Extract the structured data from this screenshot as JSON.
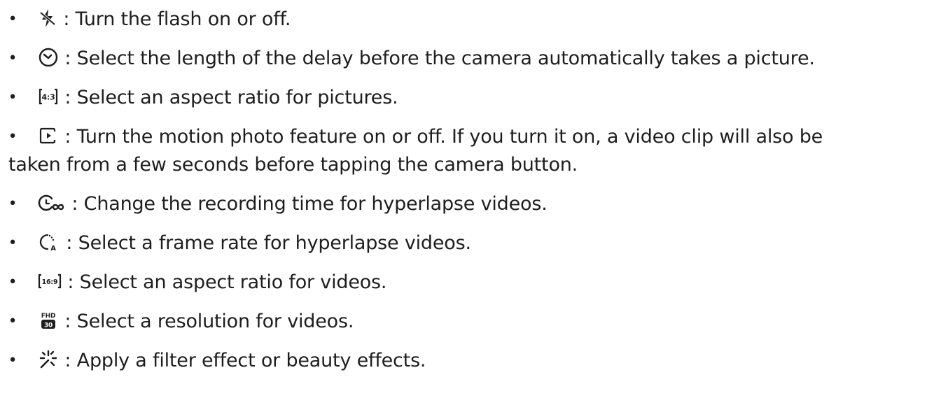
{
  "items": [
    {
      "icon": "flash-off-icon",
      "separator": " : ",
      "text": "Turn the flash on or off."
    },
    {
      "icon": "timer-icon",
      "separator": " : ",
      "text": "Select the length of the delay before the camera automatically takes a picture."
    },
    {
      "icon": "aspect-ratio-4-3-icon",
      "icon_label": "4:3",
      "separator": " : ",
      "text": "Select an aspect ratio for pictures."
    },
    {
      "icon": "motion-photo-icon",
      "separator": " : ",
      "text": "Turn the motion photo feature on or off. If you turn it on, a video clip will also be",
      "text_continued": "taken from a few seconds before tapping the camera button."
    },
    {
      "icon": "hyperlapse-time-icon",
      "separator": " : ",
      "text": "Change the recording time for hyperlapse videos."
    },
    {
      "icon": "frame-rate-auto-icon",
      "icon_label": "A",
      "separator": " : ",
      "text": "Select a frame rate for hyperlapse videos."
    },
    {
      "icon": "aspect-ratio-16-9-icon",
      "icon_label": "16:9",
      "separator": " : ",
      "text": "Select an aspect ratio for videos."
    },
    {
      "icon": "resolution-fhd-30-icon",
      "icon_label_top": "FHD",
      "icon_label_bottom": "30",
      "separator": " : ",
      "text": "Select a resolution for videos."
    },
    {
      "icon": "filter-effects-icon",
      "separator": " : ",
      "text": "Apply a filter effect or beauty effects."
    }
  ],
  "bullet_char": "•"
}
